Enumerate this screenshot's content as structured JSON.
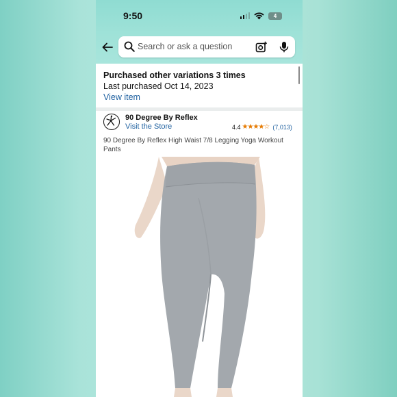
{
  "status_bar": {
    "time": "9:50",
    "battery": "4"
  },
  "search": {
    "placeholder": "Search or ask a question"
  },
  "purchase_notice": {
    "heading": "Purchased other variations 3 times",
    "last_purchased": "Last purchased Oct 14, 2023",
    "view_link": "View item"
  },
  "brand": {
    "name": "90 Degree By Reflex",
    "store_link": "Visit the Store",
    "rating": "4.4",
    "stars": "★★★★☆",
    "rating_count": "(7,013)"
  },
  "product": {
    "title": "90 Degree By Reflex High Waist 7/8 Legging Yoga Workout Pants",
    "image_icon": "leggings-photo",
    "leggings_color": "#a3a8ad"
  },
  "colors": {
    "link": "#2162a1",
    "star": "#e67a00",
    "header": "#9fe2d8"
  }
}
